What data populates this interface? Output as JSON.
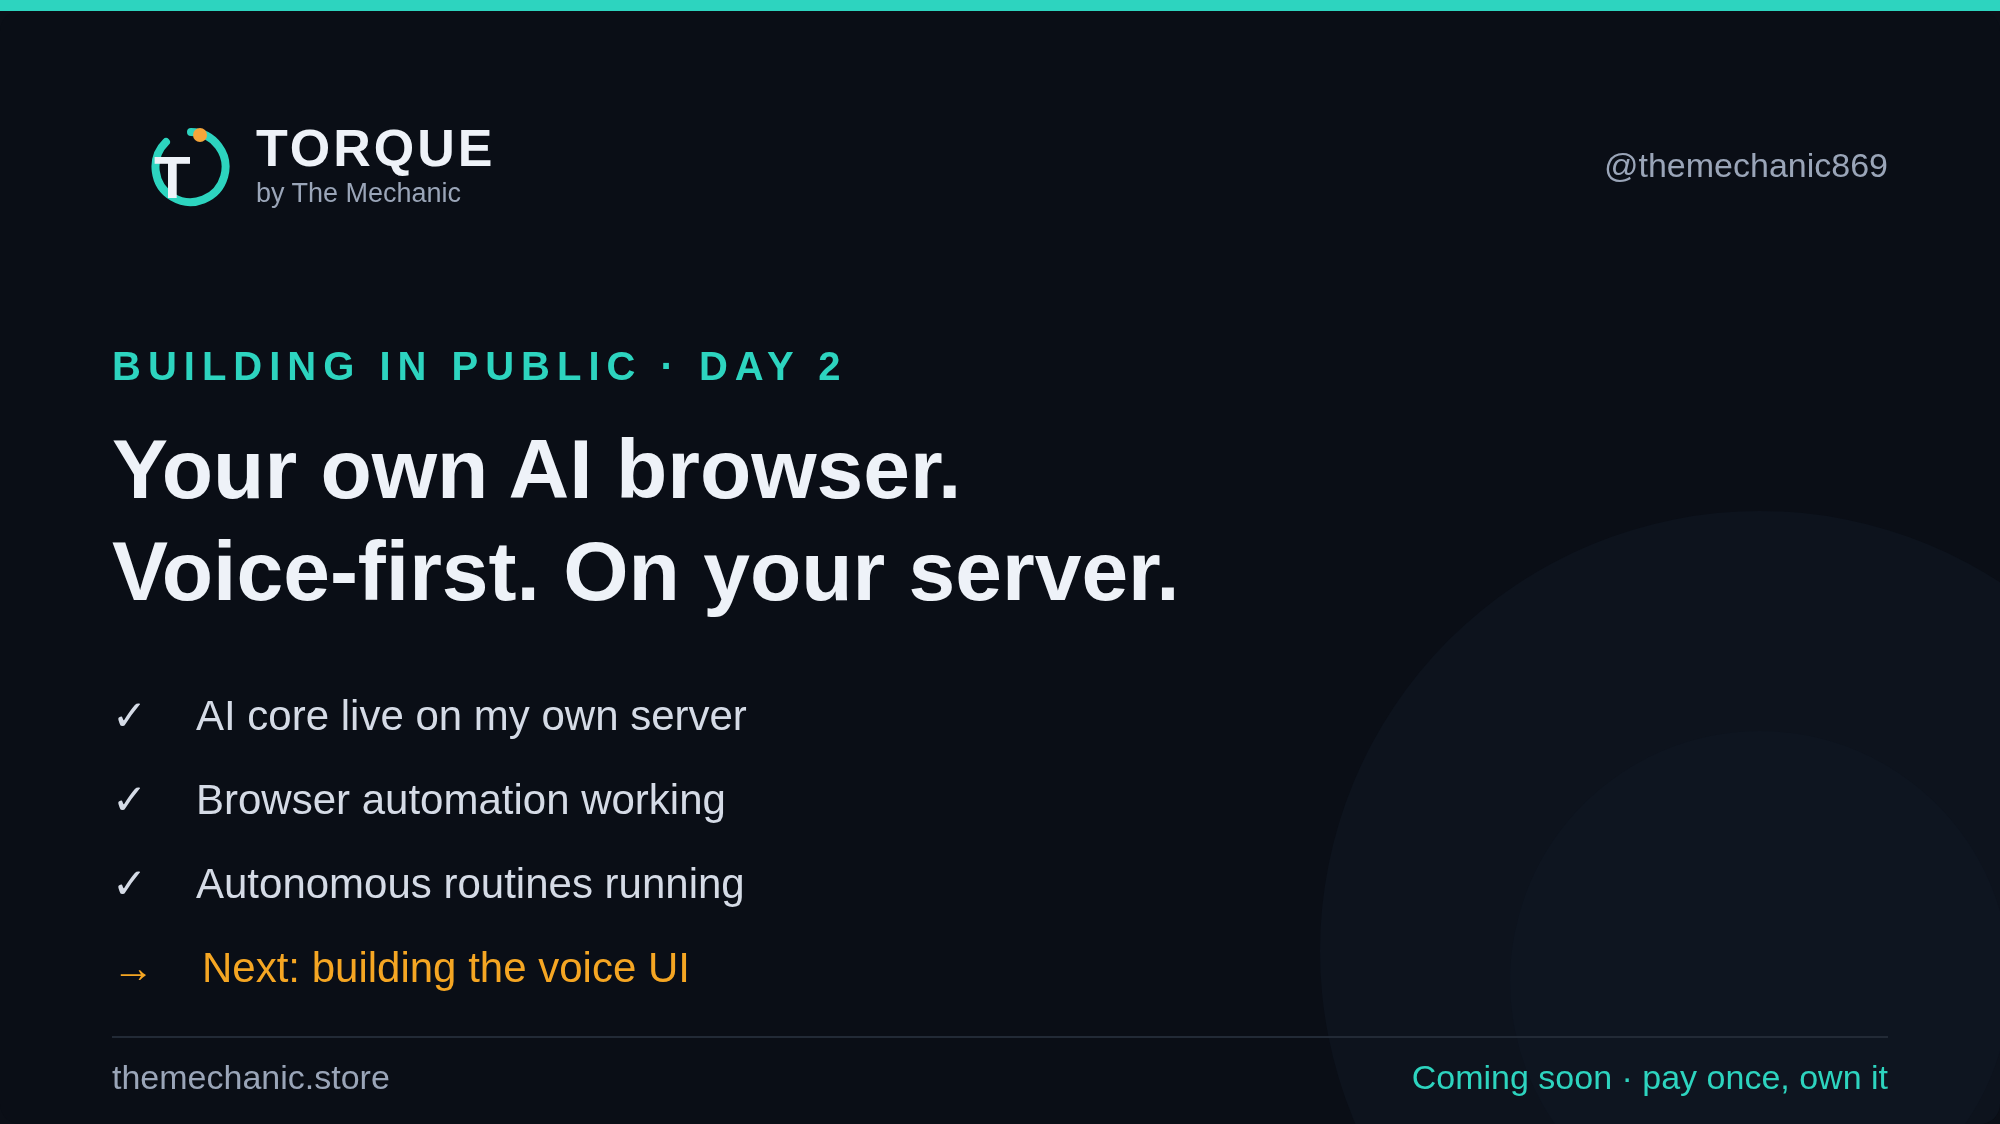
{
  "brand": {
    "logo_letter": "T",
    "name": "TORQUE",
    "byline": "by The Mechanic"
  },
  "handle": "@themechanic869",
  "eyebrow": "BUILDING IN PUBLIC · DAY 2",
  "headline": [
    "Your own AI browser.",
    "Voice-first. On your server."
  ],
  "items": [
    {
      "kind": "done",
      "mark": "✓",
      "text": "AI core live on my own server"
    },
    {
      "kind": "done",
      "mark": "✓",
      "text": "Browser automation working"
    },
    {
      "kind": "done",
      "mark": "✓",
      "text": "Autonomous routines running"
    },
    {
      "kind": "next",
      "mark": "→",
      "text": "Next: building the voice UI"
    }
  ],
  "footer": {
    "site": "themechanic.store",
    "tagline": "Coming soon · pay once, own it"
  }
}
